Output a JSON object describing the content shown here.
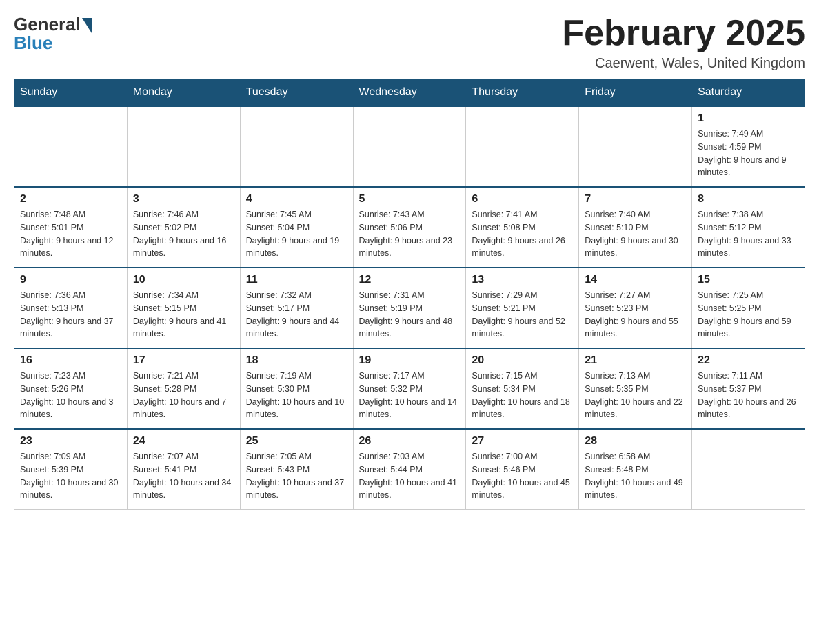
{
  "header": {
    "logo_general": "General",
    "logo_blue": "Blue",
    "month_title": "February 2025",
    "location": "Caerwent, Wales, United Kingdom"
  },
  "calendar": {
    "days_of_week": [
      "Sunday",
      "Monday",
      "Tuesday",
      "Wednesday",
      "Thursday",
      "Friday",
      "Saturday"
    ],
    "weeks": [
      [
        {
          "day": "",
          "info": ""
        },
        {
          "day": "",
          "info": ""
        },
        {
          "day": "",
          "info": ""
        },
        {
          "day": "",
          "info": ""
        },
        {
          "day": "",
          "info": ""
        },
        {
          "day": "",
          "info": ""
        },
        {
          "day": "1",
          "info": "Sunrise: 7:49 AM\nSunset: 4:59 PM\nDaylight: 9 hours and 9 minutes."
        }
      ],
      [
        {
          "day": "2",
          "info": "Sunrise: 7:48 AM\nSunset: 5:01 PM\nDaylight: 9 hours and 12 minutes."
        },
        {
          "day": "3",
          "info": "Sunrise: 7:46 AM\nSunset: 5:02 PM\nDaylight: 9 hours and 16 minutes."
        },
        {
          "day": "4",
          "info": "Sunrise: 7:45 AM\nSunset: 5:04 PM\nDaylight: 9 hours and 19 minutes."
        },
        {
          "day": "5",
          "info": "Sunrise: 7:43 AM\nSunset: 5:06 PM\nDaylight: 9 hours and 23 minutes."
        },
        {
          "day": "6",
          "info": "Sunrise: 7:41 AM\nSunset: 5:08 PM\nDaylight: 9 hours and 26 minutes."
        },
        {
          "day": "7",
          "info": "Sunrise: 7:40 AM\nSunset: 5:10 PM\nDaylight: 9 hours and 30 minutes."
        },
        {
          "day": "8",
          "info": "Sunrise: 7:38 AM\nSunset: 5:12 PM\nDaylight: 9 hours and 33 minutes."
        }
      ],
      [
        {
          "day": "9",
          "info": "Sunrise: 7:36 AM\nSunset: 5:13 PM\nDaylight: 9 hours and 37 minutes."
        },
        {
          "day": "10",
          "info": "Sunrise: 7:34 AM\nSunset: 5:15 PM\nDaylight: 9 hours and 41 minutes."
        },
        {
          "day": "11",
          "info": "Sunrise: 7:32 AM\nSunset: 5:17 PM\nDaylight: 9 hours and 44 minutes."
        },
        {
          "day": "12",
          "info": "Sunrise: 7:31 AM\nSunset: 5:19 PM\nDaylight: 9 hours and 48 minutes."
        },
        {
          "day": "13",
          "info": "Sunrise: 7:29 AM\nSunset: 5:21 PM\nDaylight: 9 hours and 52 minutes."
        },
        {
          "day": "14",
          "info": "Sunrise: 7:27 AM\nSunset: 5:23 PM\nDaylight: 9 hours and 55 minutes."
        },
        {
          "day": "15",
          "info": "Sunrise: 7:25 AM\nSunset: 5:25 PM\nDaylight: 9 hours and 59 minutes."
        }
      ],
      [
        {
          "day": "16",
          "info": "Sunrise: 7:23 AM\nSunset: 5:26 PM\nDaylight: 10 hours and 3 minutes."
        },
        {
          "day": "17",
          "info": "Sunrise: 7:21 AM\nSunset: 5:28 PM\nDaylight: 10 hours and 7 minutes."
        },
        {
          "day": "18",
          "info": "Sunrise: 7:19 AM\nSunset: 5:30 PM\nDaylight: 10 hours and 10 minutes."
        },
        {
          "day": "19",
          "info": "Sunrise: 7:17 AM\nSunset: 5:32 PM\nDaylight: 10 hours and 14 minutes."
        },
        {
          "day": "20",
          "info": "Sunrise: 7:15 AM\nSunset: 5:34 PM\nDaylight: 10 hours and 18 minutes."
        },
        {
          "day": "21",
          "info": "Sunrise: 7:13 AM\nSunset: 5:35 PM\nDaylight: 10 hours and 22 minutes."
        },
        {
          "day": "22",
          "info": "Sunrise: 7:11 AM\nSunset: 5:37 PM\nDaylight: 10 hours and 26 minutes."
        }
      ],
      [
        {
          "day": "23",
          "info": "Sunrise: 7:09 AM\nSunset: 5:39 PM\nDaylight: 10 hours and 30 minutes."
        },
        {
          "day": "24",
          "info": "Sunrise: 7:07 AM\nSunset: 5:41 PM\nDaylight: 10 hours and 34 minutes."
        },
        {
          "day": "25",
          "info": "Sunrise: 7:05 AM\nSunset: 5:43 PM\nDaylight: 10 hours and 37 minutes."
        },
        {
          "day": "26",
          "info": "Sunrise: 7:03 AM\nSunset: 5:44 PM\nDaylight: 10 hours and 41 minutes."
        },
        {
          "day": "27",
          "info": "Sunrise: 7:00 AM\nSunset: 5:46 PM\nDaylight: 10 hours and 45 minutes."
        },
        {
          "day": "28",
          "info": "Sunrise: 6:58 AM\nSunset: 5:48 PM\nDaylight: 10 hours and 49 minutes."
        },
        {
          "day": "",
          "info": ""
        }
      ]
    ]
  }
}
